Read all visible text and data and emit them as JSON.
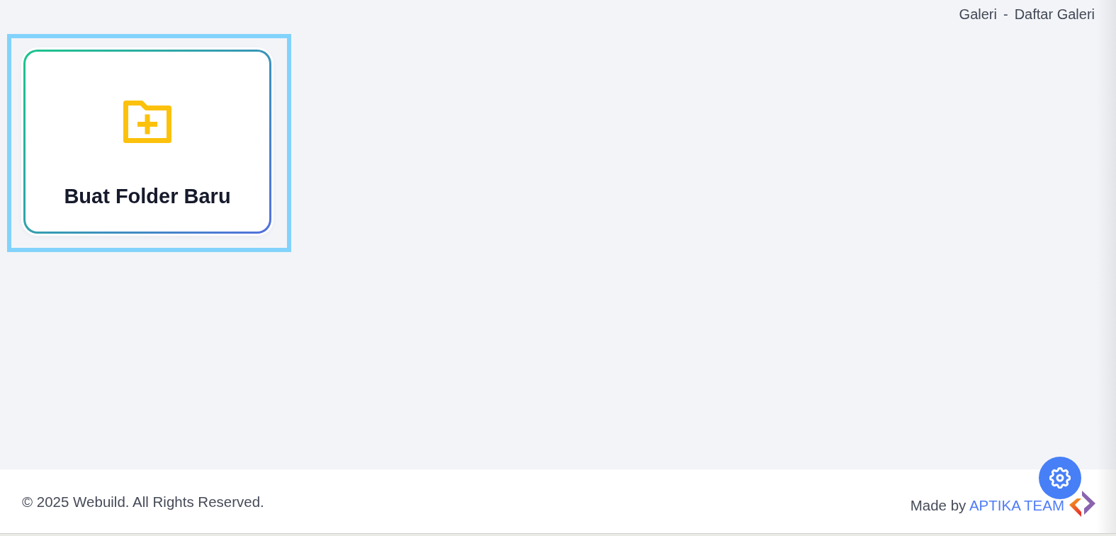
{
  "breadcrumb": {
    "items": [
      {
        "label": "Galeri"
      },
      {
        "label": "Daftar Galeri"
      }
    ],
    "separator": "-"
  },
  "folders": [
    {
      "kind": "new-folder",
      "label": "Buat Folder Baru",
      "selected": true
    }
  ],
  "footer": {
    "copyright": "© 2025 Webuild. All Rights Reserved.",
    "credit": {
      "prefix": "Made by",
      "link": "APTIKA TEAM"
    }
  }
}
